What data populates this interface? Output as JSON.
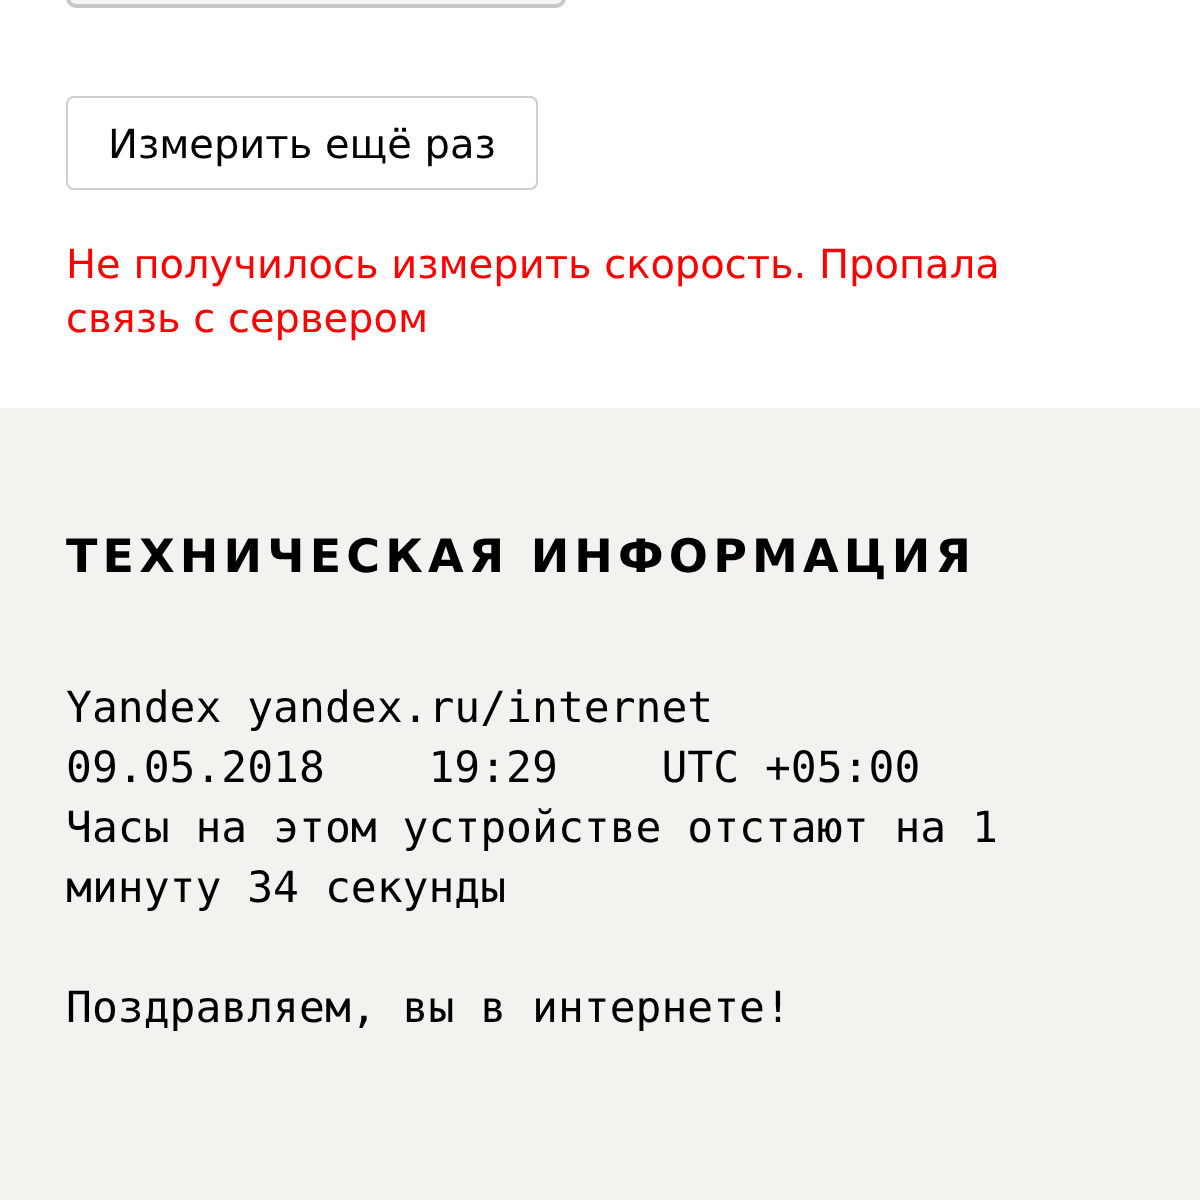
{
  "retry_button": {
    "label": "Измерить ещё раз"
  },
  "error_message": "Не получилось измерить скорость. Пропала связь с сервером",
  "technical_info": {
    "title": "ТЕХНИЧЕСКАЯ ИНФОРМАЦИЯ",
    "paragraphs": [
      [
        "Yandex yandex.ru/internet",
        "09.05.2018    19:29    UTC +05:00",
        "Часы на этом устройстве отстают на 1 минуту 34 секунды"
      ],
      [
        "Поздравляем, вы в интернете!"
      ]
    ]
  }
}
